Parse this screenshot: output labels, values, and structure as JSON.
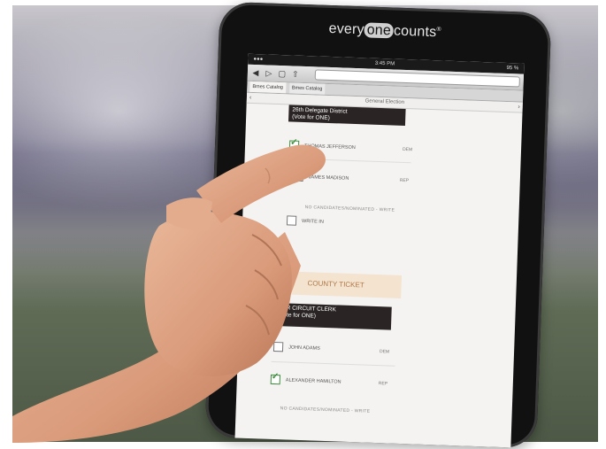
{
  "photo_description_free": true,
  "device": {
    "brand_left": "every",
    "brand_mid": "one",
    "brand_right": "counts",
    "brand_tm": "®"
  },
  "screen": {
    "time": "3:45 PM",
    "battery": "95 %",
    "tabs": [
      "Bmes Catalog",
      "Bmes Catalog"
    ],
    "page_title": "General Election",
    "header1_line1": "26th Delegate District",
    "header1_line2": "(Vote for ONE)",
    "candidates_top": [
      {
        "name": "THOMAS JEFFERSON",
        "party": "DEM",
        "checked": true
      },
      {
        "name": "JAMES MADISON",
        "party": "REP",
        "checked": false
      }
    ],
    "writein_note_top": "NO CANDIDATES/NOMINATED - WRITE",
    "writein_top": "WRITE IN",
    "county_ticket": "COUNTY TICKET",
    "header2_line1": "FOR CIRCUIT CLERK",
    "header2_line2": "(Vote for ONE)",
    "candidates_bottom": [
      {
        "name": "JOHN ADAMS",
        "party": "DEM",
        "checked": false
      },
      {
        "name": "ALEXANDER HAMILTON",
        "party": "REP",
        "checked": true
      }
    ],
    "writein_note_bottom": "NO CANDIDATES/NOMINATED - WRITE"
  },
  "colors": {
    "bezel": "#111111",
    "dark_header": "#2a2424",
    "county_bg": "#f3e3cf",
    "county_text": "#b07848",
    "check": "#3b8a3b"
  }
}
